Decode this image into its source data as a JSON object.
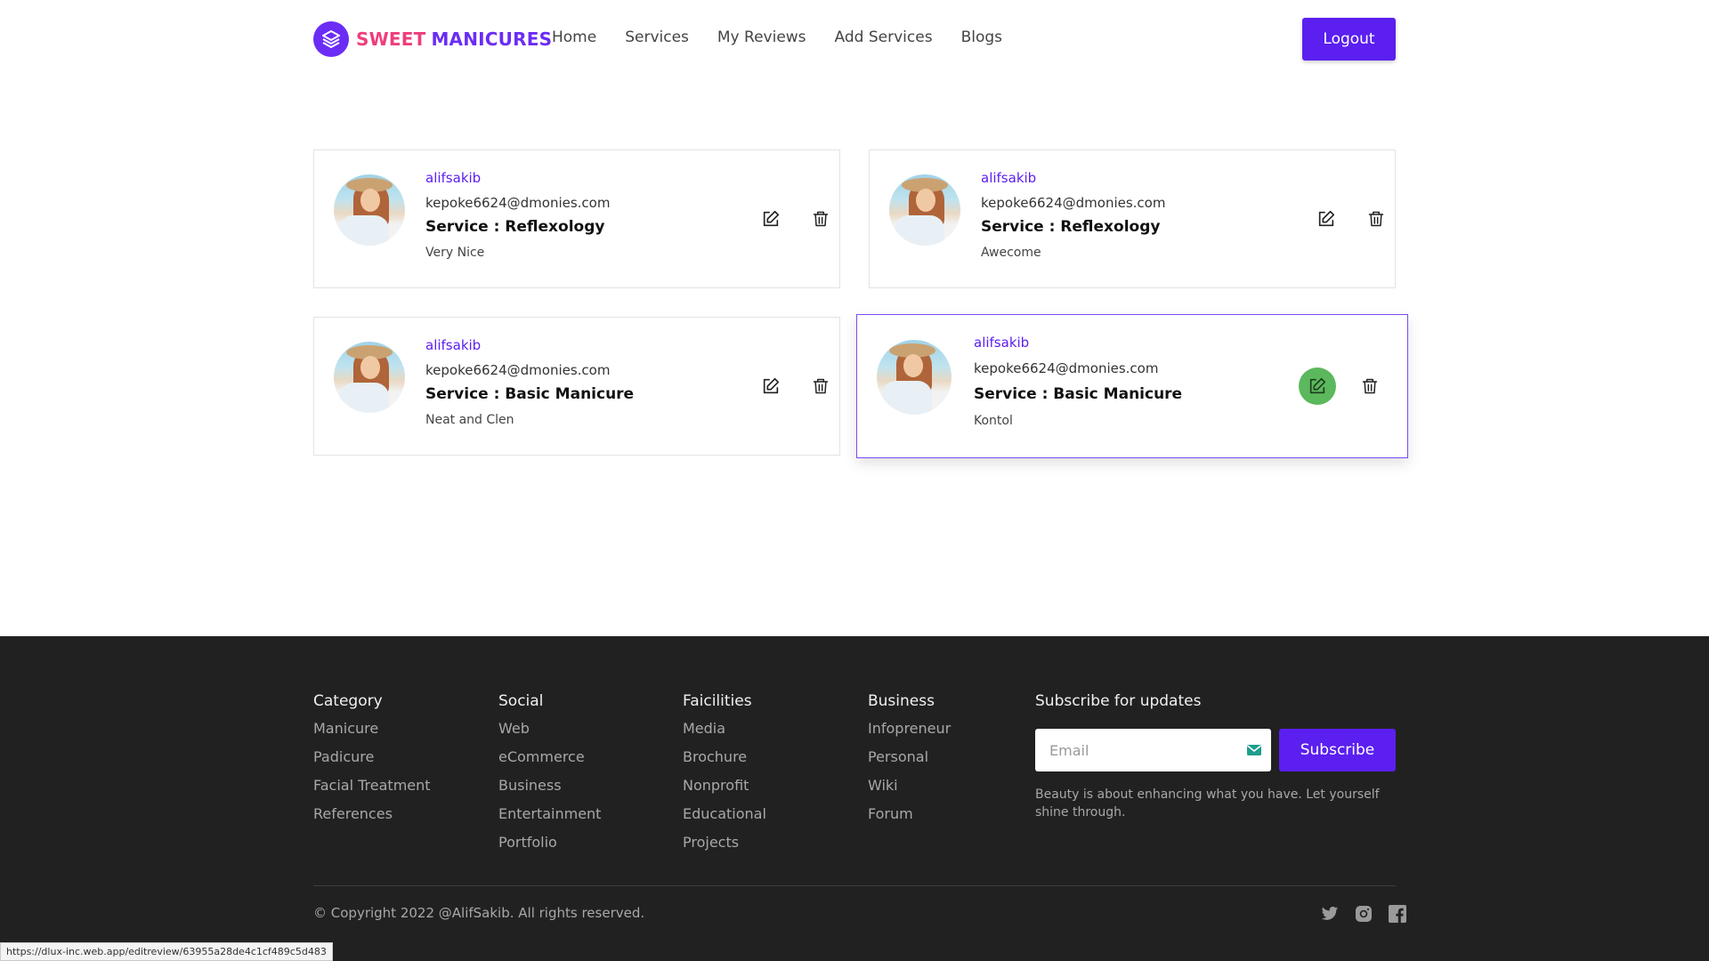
{
  "brand": {
    "word1": "SWEET",
    "word2": "MANICURES",
    "logo_icon": "stacked-layers-icon"
  },
  "nav": [
    {
      "label": "Home"
    },
    {
      "label": "Services"
    },
    {
      "label": "My Reviews"
    },
    {
      "label": "Add Services"
    },
    {
      "label": "Blogs"
    }
  ],
  "logout_label": "Logout",
  "reviews": [
    {
      "name": "alifsakib",
      "email": "kepoke6624@dmonies.com",
      "service": "Service : Reflexology",
      "comment": "Very Nice"
    },
    {
      "name": "alifsakib",
      "email": "kepoke6624@dmonies.com",
      "service": "Service : Reflexology",
      "comment": "Awecome"
    },
    {
      "name": "alifsakib",
      "email": "kepoke6624@dmonies.com",
      "service": "Service : Basic Manicure",
      "comment": "Neat and Clen"
    },
    {
      "name": "alifsakib",
      "email": "kepoke6624@dmonies.com",
      "service": "Service : Basic Manicure",
      "comment": "Kontol"
    }
  ],
  "colors": {
    "accent": "#5b1ff0",
    "pink": "#ee3e7d",
    "edit_hover": "#5cb85c",
    "footer_bg": "#212121"
  },
  "footer": {
    "columns": [
      {
        "title": "Category",
        "items": [
          "Manicure",
          "Padicure",
          "Facial Treatment",
          "References"
        ]
      },
      {
        "title": "Social",
        "items": [
          "Web",
          "eCommerce",
          "Business",
          "Entertainment",
          "Portfolio"
        ]
      },
      {
        "title": "Faicilities",
        "items": [
          "Media",
          "Brochure",
          "Nonprofit",
          "Educational",
          "Projects"
        ]
      },
      {
        "title": "Business",
        "items": [
          "Infopreneur",
          "Personal",
          "Wiki",
          "Forum"
        ]
      }
    ],
    "subscribe_title": "Subscribe for updates",
    "email_placeholder": "Email",
    "subscribe_label": "Subscribe",
    "tagline": "Beauty is about enhancing what you have. Let yourself shine through.",
    "copyright": "© Copyright 2022 @AlifSakib. All rights reserved.",
    "social_icons": [
      "twitter-icon",
      "instagram-icon",
      "facebook-icon"
    ]
  },
  "status_url": "https://dlux-inc.web.app/editreview/63955a28de4c1cf489c5d483"
}
